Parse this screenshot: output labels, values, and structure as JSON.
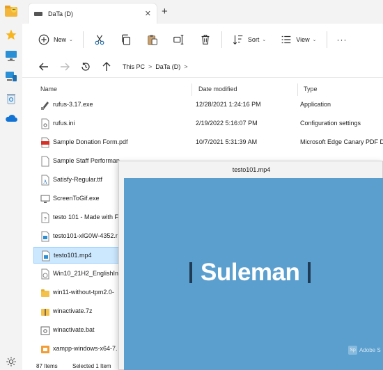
{
  "window": {
    "tab_title": "DaTa (D)",
    "new_tab_symbol": "+",
    "close_symbol": "✕"
  },
  "toolbar": {
    "new_label": "New",
    "sort_label": "Sort",
    "view_label": "View",
    "more_symbol": "···"
  },
  "address": {
    "crumbs": [
      "This PC",
      "DaTa (D)"
    ],
    "separator": ">"
  },
  "columns": {
    "name": "Name",
    "date": "Date modified",
    "type": "Type"
  },
  "files": [
    {
      "name": "rufus-3.17.exe",
      "date": "12/28/2021 1:24:16 PM",
      "type": "Application",
      "icon": "usb-drive-icon"
    },
    {
      "name": "rufus.ini",
      "date": "2/19/2022 5:16:07 PM",
      "type": "Configuration settings",
      "icon": "settings-file-icon"
    },
    {
      "name": "Sample Donation Form.pdf",
      "date": "10/7/2021 5:31:39 AM",
      "type": "Microsoft Edge Canary PDF Do",
      "icon": "pdf-icon"
    },
    {
      "name": "Sample Staff Performan",
      "date": "",
      "type": "",
      "icon": "document-icon"
    },
    {
      "name": "Satisfy-Regular.ttf",
      "date": "",
      "type": "",
      "icon": "font-file-icon"
    },
    {
      "name": "ScreenToGif.exe",
      "date": "",
      "type": "",
      "icon": "monitor-icon"
    },
    {
      "name": "testo 101 - Made with F",
      "date": "",
      "type": "",
      "icon": "unknown-file-icon"
    },
    {
      "name": "testo101-xlG0W-4352.r",
      "date": "",
      "type": "",
      "icon": "video-file-icon"
    },
    {
      "name": "testo101.mp4",
      "date": "",
      "type": "",
      "icon": "video-file-icon",
      "selected": true
    },
    {
      "name": "Win10_21H2_EnglishInt",
      "date": "",
      "type": "",
      "icon": "disc-image-icon"
    },
    {
      "name": "win11-without-tpm2.0-",
      "date": "",
      "type": "",
      "icon": "folder-icon"
    },
    {
      "name": "winactivate.7z",
      "date": "",
      "type": "",
      "icon": "archive-icon"
    },
    {
      "name": "winactivate.bat",
      "date": "",
      "type": "",
      "icon": "gear-file-icon"
    },
    {
      "name": "xampp-windows-x64-7.",
      "date": "",
      "type": "",
      "icon": "installer-icon"
    }
  ],
  "status": {
    "items_count": "87 Items",
    "selected": "Selected  1  Item"
  },
  "popup": {
    "title": "testo101.mp4",
    "caption": "Suleman",
    "watermark": "Adobe S"
  },
  "colors": {
    "accent": "#0067c0",
    "video_bg": "#5b9fcf",
    "selection": "#cce8ff"
  }
}
